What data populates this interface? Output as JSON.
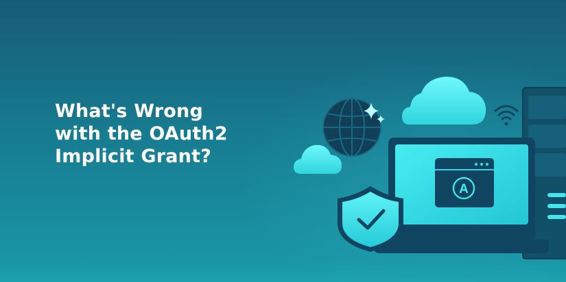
{
  "banner": {
    "headline_lines": [
      "What's Wrong",
      "with the OAuth2",
      "Implicit Grant?"
    ],
    "app_badge_letter": "A"
  },
  "icons": [
    "globe-icon",
    "sparkle-icon",
    "cloud-icon",
    "wifi-icon",
    "shield-check-icon",
    "browser-window-icon",
    "server-rack-icon"
  ],
  "colors": {
    "background_top": "#155b76",
    "background_bottom": "#1a9aa9",
    "accent_cyan": "#3ef0f5",
    "dark_navy": "#0f4560",
    "headline_text": "#ffffff"
  }
}
